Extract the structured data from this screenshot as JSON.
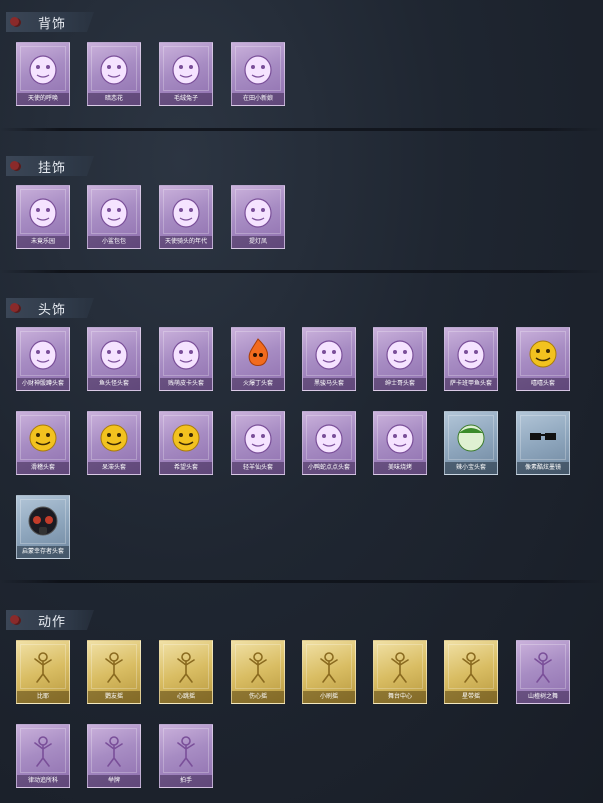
{
  "sections": [
    {
      "title": "背饰",
      "items": [
        {
          "label": "天使的呼唤",
          "icon": "angel-icon",
          "tone": "purple"
        },
        {
          "label": "暗恋花",
          "icon": "flower-icon",
          "tone": "purple"
        },
        {
          "label": "毛绒兔子",
          "icon": "plush-toy-icon",
          "tone": "purple"
        },
        {
          "label": "在田小新娘",
          "icon": "lantern-icon",
          "tone": "purple"
        }
      ]
    },
    {
      "title": "挂饰",
      "items": [
        {
          "label": "未竟乐园",
          "icon": "fairy-doll-icon",
          "tone": "purple"
        },
        {
          "label": "小鲨包包",
          "icon": "shark-plush-icon",
          "tone": "purple"
        },
        {
          "label": "天使骑头的年代",
          "icon": "portrait-charm-icon",
          "tone": "purple"
        },
        {
          "label": "提灯凤",
          "icon": "doll-charm-icon",
          "tone": "purple"
        }
      ]
    },
    {
      "title": "头饰",
      "items": [
        {
          "label": "小财神骰蹲头套",
          "icon": "pig-mask-icon",
          "tone": "purple"
        },
        {
          "label": "鱼头怪头套",
          "icon": "fish-mask-icon",
          "tone": "purple"
        },
        {
          "label": "贱萌皮卡头套",
          "icon": "pikachu-mask-icon",
          "tone": "purple"
        },
        {
          "label": "火爆丁头套",
          "icon": "flame-mask-icon",
          "tone": "purple"
        },
        {
          "label": "黑骏马头套",
          "icon": "horse-mask-icon",
          "tone": "purple"
        },
        {
          "label": "绅士哥头套",
          "icon": "dog-mask-icon",
          "tone": "purple"
        },
        {
          "label": "萨卡班甲鱼头套",
          "icon": "fish-head-icon",
          "tone": "purple"
        },
        {
          "label": "嘻嘻头套",
          "icon": "grin-emoji-icon",
          "tone": "purple"
        },
        {
          "label": "滑稽头套",
          "icon": "smirk-emoji-icon",
          "tone": "purple"
        },
        {
          "label": "呆滞头套",
          "icon": "dazed-emoji-icon",
          "tone": "purple"
        },
        {
          "label": "希望头套",
          "icon": "worried-emoji-icon",
          "tone": "purple"
        },
        {
          "label": "轻羊仙头套",
          "icon": "raccoon-mask-icon",
          "tone": "purple"
        },
        {
          "label": "小鸭蛇点点头套",
          "icon": "cartoon-face-icon",
          "tone": "purple"
        },
        {
          "label": "美味烧烤",
          "icon": "toast-mask-icon",
          "tone": "purple"
        },
        {
          "label": "辣小宝头套",
          "icon": "melon-mask-icon",
          "tone": "blue"
        },
        {
          "label": "像素酷炫墨镜",
          "icon": "pixel-sunglasses-icon",
          "tone": "blue"
        },
        {
          "label": "启蒙幸存者头套",
          "icon": "gas-mask-icon",
          "tone": "blue"
        }
      ]
    },
    {
      "title": "动作",
      "items": [
        {
          "label": "比耶",
          "icon": "pose-victory-icon",
          "tone": "gold"
        },
        {
          "label": "鹦友摇",
          "icon": "pose-wave-icon",
          "tone": "gold"
        },
        {
          "label": "心跳摇",
          "icon": "pose-heart-icon",
          "tone": "gold"
        },
        {
          "label": "伤心摇",
          "icon": "pose-sad-icon",
          "tone": "gold"
        },
        {
          "label": "小刷摇",
          "icon": "pose-dance-icon",
          "tone": "gold"
        },
        {
          "label": "舞台中心",
          "icon": "pose-stage-icon",
          "tone": "gold"
        },
        {
          "label": "星带摇",
          "icon": "pose-star-icon",
          "tone": "gold"
        },
        {
          "label": "山楂树之舞",
          "icon": "pose-tree-icon",
          "tone": "purple"
        },
        {
          "label": "律动追所科",
          "icon": "pose-groove-icon",
          "tone": "purple"
        },
        {
          "label": "举牌",
          "icon": "pose-sign-icon",
          "tone": "purple"
        },
        {
          "label": "拍手",
          "icon": "pose-clap-icon",
          "tone": "purple"
        }
      ]
    }
  ]
}
